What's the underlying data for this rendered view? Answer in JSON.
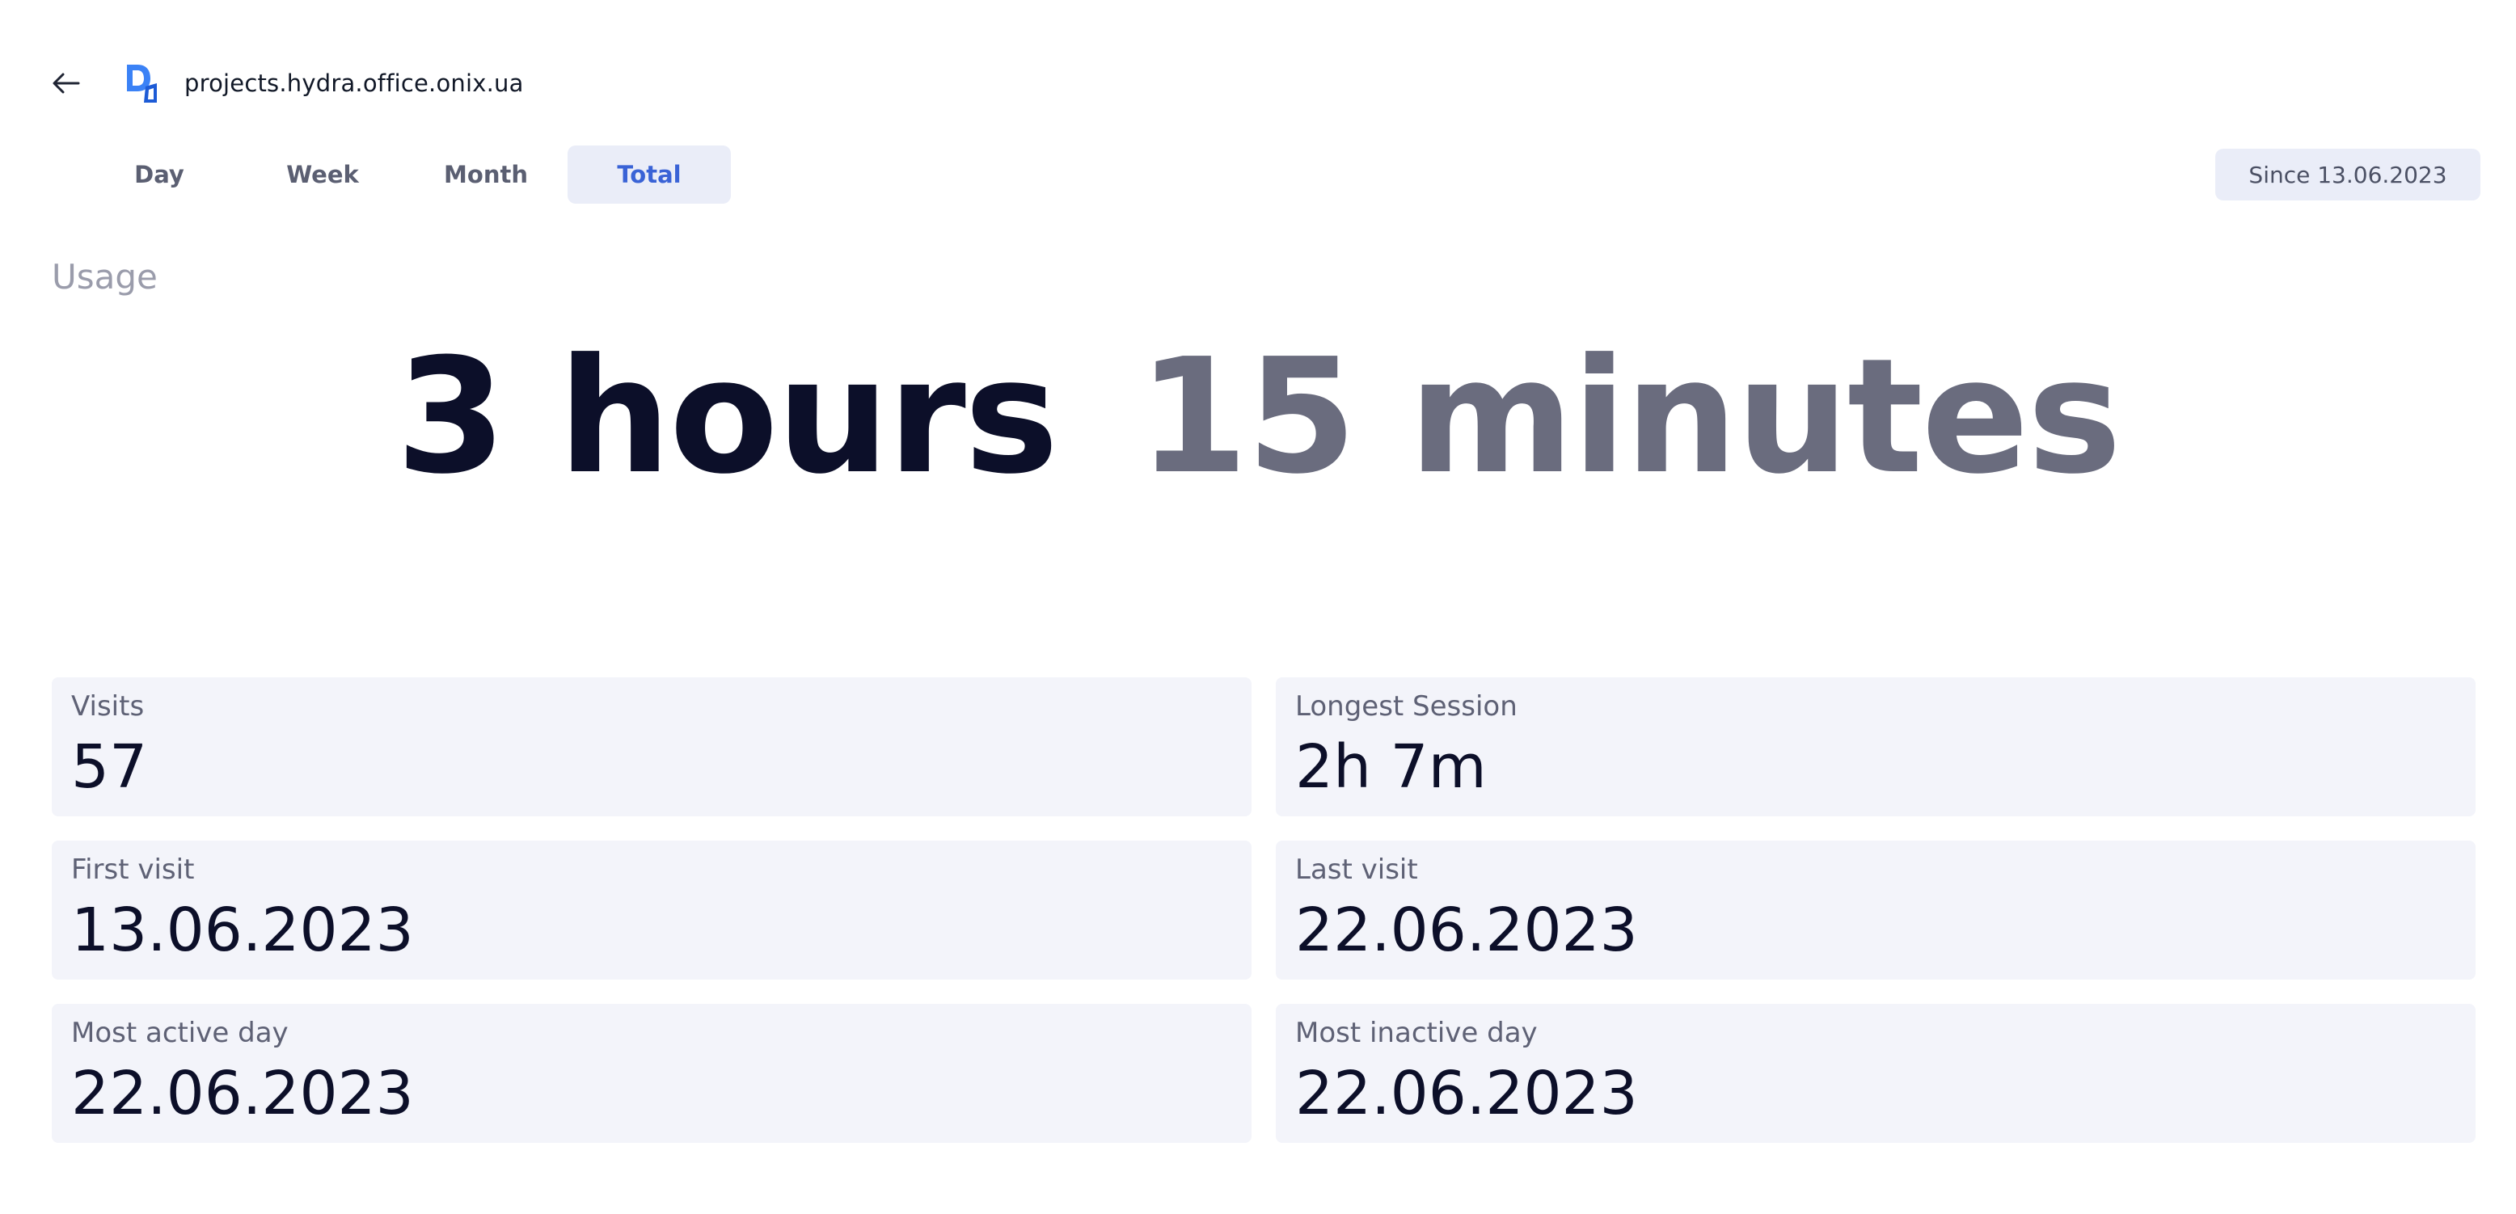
{
  "header": {
    "domain": "projects.hydra.office.onix.ua"
  },
  "tabs": [
    {
      "label": "Day",
      "active": false
    },
    {
      "label": "Week",
      "active": false
    },
    {
      "label": "Month",
      "active": false
    },
    {
      "label": "Total",
      "active": true
    }
  ],
  "since_label": "Since 13.06.2023",
  "usage": {
    "label": "Usage",
    "hours": "3 hours",
    "minutes": "15 minutes"
  },
  "stats": {
    "visits": {
      "label": "Visits",
      "value": "57"
    },
    "longest_session": {
      "label": "Longest Session",
      "value": "2h 7m"
    },
    "first_visit": {
      "label": "First visit",
      "value": "13.06.2023"
    },
    "last_visit": {
      "label": "Last visit",
      "value": "22.06.2023"
    },
    "most_active_day": {
      "label": "Most active day",
      "value": "22.06.2023"
    },
    "most_inactive_day": {
      "label": "Most inactive day",
      "value": "22.06.2023"
    }
  },
  "colors": {
    "accent": "#3a63d6",
    "tab_active_bg": "#eaedf8",
    "card_bg": "#f3f4fa",
    "text_dark": "#0c0f29",
    "text_muted": "#6a6c7e"
  },
  "icons": {
    "back": "arrow-left-icon",
    "logo": "site-logo-icon"
  }
}
